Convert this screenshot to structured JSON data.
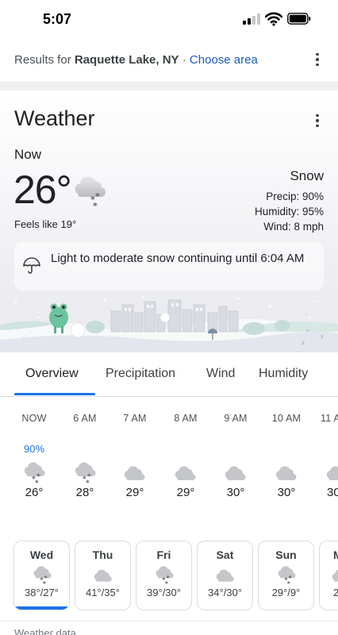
{
  "status_bar": {
    "time": "5:07"
  },
  "location_bar": {
    "prefix": "Results for ",
    "location": "Raquette Lake, NY",
    "separator": " · ",
    "choose_area": "Choose area"
  },
  "weather": {
    "title": "Weather",
    "now_label": "Now",
    "temperature": "26°",
    "feels_like": "Feels like 19°",
    "condition": "Snow",
    "precip": "Precip: 90%",
    "humidity": "Humidity: 95%",
    "wind": "Wind: 8 mph",
    "alert": "Light to moderate snow continuing until 6:04 AM",
    "icon": "cloud-snow-icon"
  },
  "tabs": [
    "Overview",
    "Precipitation",
    "Wind",
    "Humidity"
  ],
  "hourly": [
    {
      "time": "NOW",
      "precip": "90%",
      "temp": "26°",
      "icon": "snow"
    },
    {
      "time": "6 AM",
      "precip": "",
      "temp": "28°",
      "icon": "snow"
    },
    {
      "time": "7 AM",
      "precip": "",
      "temp": "29°",
      "icon": "cloud"
    },
    {
      "time": "8 AM",
      "precip": "",
      "temp": "29°",
      "icon": "cloud"
    },
    {
      "time": "9 AM",
      "precip": "",
      "temp": "30°",
      "icon": "cloud"
    },
    {
      "time": "10 AM",
      "precip": "",
      "temp": "30°",
      "icon": "cloud"
    },
    {
      "time": "11 A",
      "precip": "",
      "temp": "30",
      "icon": "cloud"
    }
  ],
  "daily": [
    {
      "day": "Wed",
      "range": "38°/27°",
      "icon": "snow",
      "selected": true
    },
    {
      "day": "Thu",
      "range": "41°/35°",
      "icon": "cloud",
      "selected": false
    },
    {
      "day": "Fri",
      "range": "39°/30°",
      "icon": "snow",
      "selected": false
    },
    {
      "day": "Sat",
      "range": "34°/30°",
      "icon": "cloud",
      "selected": false
    },
    {
      "day": "Sun",
      "range": "29°/9°",
      "icon": "snow",
      "selected": false
    },
    {
      "day": "M",
      "range": "2",
      "icon": "cloud",
      "selected": false
    }
  ],
  "footer": "Weather data",
  "colors": {
    "accent": "#1a73e8",
    "link": "#1a5bc4"
  }
}
